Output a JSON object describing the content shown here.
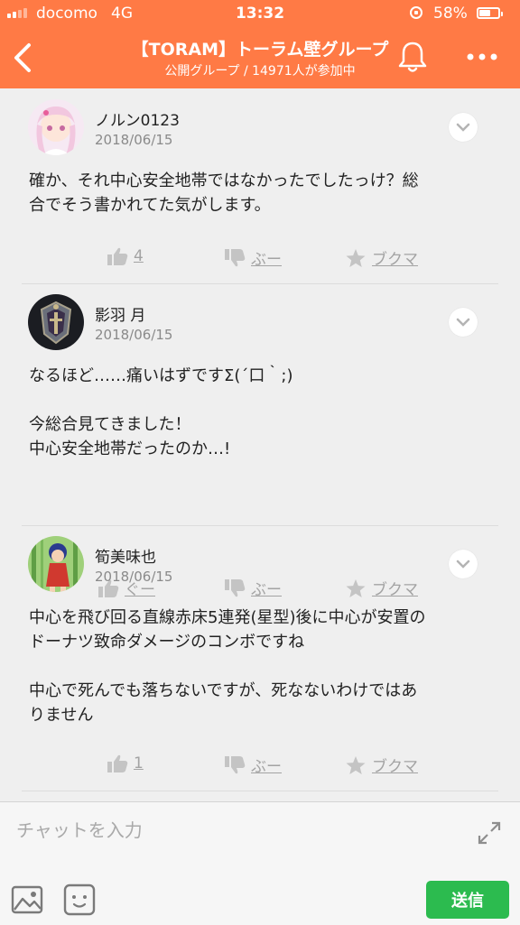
{
  "status_bar": {
    "carrier": "docomo",
    "network": "4G",
    "time": "13:32",
    "battery": "58%"
  },
  "header": {
    "title": "【TORAM】トーラム壁グループ",
    "subtitle": "公開グループ / 14971人が参加中"
  },
  "comments": [
    {
      "username": "ノルン0123",
      "date": "2018/06/15",
      "lines": [
        "確か、それ中心安全地帯ではなかったでしたっけ？総",
        "合でそう書かれてた気がします。"
      ],
      "like_label": "4",
      "dislike_label": "ぶー",
      "bookmark_label": "ブクマ"
    },
    {
      "username": "影羽 月",
      "date": "2018/06/15",
      "lines": [
        "なるほど……痛いはずですΣ(´口｀;)",
        "",
        "今総合見てきました！",
        "中心安全地帯だったのか…!"
      ],
      "like_label": "ぐー",
      "dislike_label": "ぶー",
      "bookmark_label": "ブクマ"
    },
    {
      "username": "筍美味也",
      "date": "2018/06/15",
      "lines": [
        "中心を飛び回る直線赤床5連発(星型)後に中心が安置の",
        "ドーナツ致命ダメージのコンボですね",
        "",
        "中心で死んでも落ちないですが、死なないわけではあ",
        "りません"
      ],
      "like_label": "1",
      "dislike_label": "ぶー",
      "bookmark_label": "ブクマ"
    }
  ],
  "input": {
    "placeholder": "チャットを入力",
    "send_label": "送信"
  },
  "colors": {
    "header": "#ff7a45",
    "send": "#2cbb4f",
    "muted": "#a3a3a3"
  },
  "icons": [
    "back-icon",
    "bell-icon",
    "more-icon",
    "chevron-down-icon",
    "thumbs-up-icon",
    "thumbs-down-icon",
    "star-icon",
    "expand-icon",
    "image-icon",
    "emoji-icon"
  ]
}
